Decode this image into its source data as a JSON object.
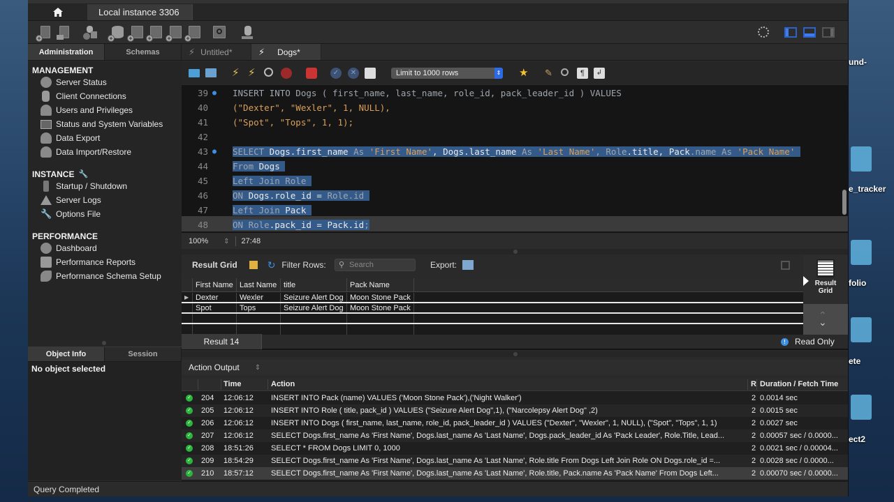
{
  "desktop": {
    "labels": [
      "und-",
      "e_tracker",
      "folio",
      "ete",
      "ect2"
    ]
  },
  "window": {
    "connection_tab": "Local instance 3306"
  },
  "main_toolbar": {
    "icons": [
      "new-sql-tab-icon",
      "open-sql-script-icon",
      "schema-inspector-icon",
      "create-schema-icon",
      "create-table-icon",
      "create-view-icon",
      "create-procedure-icon",
      "create-function-icon",
      "search-table-data-icon",
      "reconnect-icon"
    ],
    "layout_toggles": [
      "settings-gear-icon",
      "toggle-sidebar-icon",
      "toggle-output-icon",
      "toggle-secondary-sidebar-icon"
    ]
  },
  "sidebar_tabs": [
    {
      "label": "Administration",
      "active": true
    },
    {
      "label": "Schemas",
      "active": false
    }
  ],
  "sidebar": {
    "sections": [
      {
        "title": "MANAGEMENT",
        "items": [
          {
            "label": "Server Status",
            "icon": "play-circle-icon"
          },
          {
            "label": "Client Connections",
            "icon": "database-client-icon"
          },
          {
            "label": "Users and Privileges",
            "icon": "user-icon"
          },
          {
            "label": "Status and System Variables",
            "icon": "monitor-icon"
          },
          {
            "label": "Data Export",
            "icon": "export-icon"
          },
          {
            "label": "Data Import/Restore",
            "icon": "import-icon"
          }
        ]
      },
      {
        "title": "INSTANCE",
        "items": [
          {
            "label": "Startup / Shutdown",
            "icon": "traffic-light-icon"
          },
          {
            "label": "Server Logs",
            "icon": "warning-icon"
          },
          {
            "label": "Options File",
            "icon": "wrench-icon"
          }
        ]
      },
      {
        "title": "PERFORMANCE",
        "items": [
          {
            "label": "Dashboard",
            "icon": "gauge-icon"
          },
          {
            "label": "Performance Reports",
            "icon": "reports-icon"
          },
          {
            "label": "Performance Schema Setup",
            "icon": "schema-setup-icon"
          }
        ]
      }
    ]
  },
  "info_tabs": [
    {
      "label": "Object Info",
      "active": true
    },
    {
      "label": "Session",
      "active": false
    }
  ],
  "info_panel": {
    "text": "No object selected"
  },
  "doc_tabs": [
    {
      "label": "Untitled*",
      "active": false
    },
    {
      "label": "Dogs*",
      "active": true
    }
  ],
  "sql_toolbar": {
    "limit_select": "Limit to 1000 rows"
  },
  "editor": {
    "lines": [
      {
        "n": "39",
        "marker": true
      },
      {
        "n": "40",
        "marker": false
      },
      {
        "n": "41",
        "marker": false
      },
      {
        "n": "42",
        "marker": false
      },
      {
        "n": "43",
        "marker": true
      },
      {
        "n": "44",
        "marker": false
      },
      {
        "n": "45",
        "marker": false
      },
      {
        "n": "46",
        "marker": false
      },
      {
        "n": "47",
        "marker": false
      },
      {
        "n": "48",
        "marker": false
      }
    ],
    "code": {
      "l39": "INSERT INTO Dogs ( first_name, last_name, role_id, pack_leader_id ) VALUES",
      "l40": "(\"Dexter\", \"Wexler\", 1, NULL),",
      "l41": "(\"Spot\", \"Tops\", 1, 1);",
      "l43a": "SELECT",
      "l43b": " Dogs",
      "l43c": ".first_name ",
      "l43d": "As",
      "l43e": " 'First Name'",
      "l43f": ", Dogs",
      "l43g": ".last_name ",
      "l43h": "As",
      "l43i": " 'Last Name'",
      "l43j": ", Role",
      "l43k": ".title",
      "l43l": ", Pack",
      "l43m": ".name ",
      "l43n": "As",
      "l43o": " 'Pack Name'",
      "l44a": "From",
      "l44b": " Dogs",
      "l45a": "Left Join",
      "l45b": " Role",
      "l46a": "ON",
      "l46b": " Dogs",
      "l46c": ".role_id = ",
      "l46d": "Role.id",
      "l47a": "Left Join",
      "l47b": " Pack",
      "l48a": "ON",
      "l48b": " Role",
      "l48c": ".pack_id = ",
      "l48d": "Pack.id",
      "l48e": ";"
    },
    "zoom": "100%",
    "cursor": "27:48"
  },
  "result_toolbar": {
    "title": "Result Grid",
    "filter_label": "Filter Rows:",
    "search_placeholder": "Search",
    "export_label": "Export:"
  },
  "result_grid": {
    "columns": [
      "First Name",
      "Last Name",
      "title",
      "Pack Name"
    ],
    "rows": [
      [
        "Dexter",
        "Wexler",
        "Seizure Alert Dog",
        "Moon Stone Pack"
      ],
      [
        "Spot",
        "Tops",
        "Seizure Alert Dog",
        "Moon Stone Pack"
      ]
    ]
  },
  "side_panel": {
    "result_grid_label_1": "Result",
    "result_grid_label_2": "Grid"
  },
  "result_tabs": {
    "active": "Result 14",
    "read_only": "Read Only"
  },
  "action_output": {
    "title": "Action Output",
    "columns": [
      "",
      "",
      "Time",
      "Action",
      "R",
      "Duration / Fetch Time"
    ],
    "rows": [
      {
        "status": "ok",
        "id": "204",
        "time": "12:06:12",
        "action": "INSERT INTO Pack (name) VALUES ('Moon Stone Pack'),('Night Walker')",
        "r": "2",
        "duration": "0.0014 sec"
      },
      {
        "status": "ok",
        "id": "205",
        "time": "12:06:12",
        "action": "INSERT INTO Role ( title, pack_id ) VALUES (\"Seizure Alert Dog\",1), (\"Narcolepsy Alert Dog\" ,2)",
        "r": "2",
        "duration": "0.0015 sec"
      },
      {
        "status": "ok",
        "id": "206",
        "time": "12:06:12",
        "action": "INSERT INTO Dogs ( first_name, last_name, role_id, pack_leader_id ) VALUES (\"Dexter\", \"Wexler\", 1, NULL), (\"Spot\", \"Tops\", 1, 1)",
        "r": "2",
        "duration": "0.0027 sec"
      },
      {
        "status": "ok",
        "id": "207",
        "time": "12:06:12",
        "action": "SELECT Dogs.first_name As 'First Name', Dogs.last_name As 'Last Name', Dogs.pack_leader_id As 'Pack Leader', Role.Title, Lead...",
        "r": "2",
        "duration": "0.00057 sec / 0.0000..."
      },
      {
        "status": "ok",
        "id": "208",
        "time": "18:51:26",
        "action": "SELECT * FROM Dogs LIMIT 0, 1000",
        "r": "2",
        "duration": "0.0021 sec / 0.00004..."
      },
      {
        "status": "ok",
        "id": "209",
        "time": "18:54:29",
        "action": "SELECT Dogs.first_name As 'First Name', Dogs.last_name As 'Last Name', Role.title From Dogs Left Join Role ON Dogs.role_id =...",
        "r": "2",
        "duration": "0.0028 sec / 0.0000..."
      },
      {
        "status": "ok",
        "id": "210",
        "time": "18:57:12",
        "action": "SELECT Dogs.first_name As 'First Name', Dogs.last_name As 'Last Name', Role.title, Pack.name As 'Pack Name' From Dogs Left...",
        "r": "2",
        "duration": "0.00070 sec / 0.0000..."
      }
    ]
  },
  "statusbar": {
    "text": "Query Completed"
  }
}
